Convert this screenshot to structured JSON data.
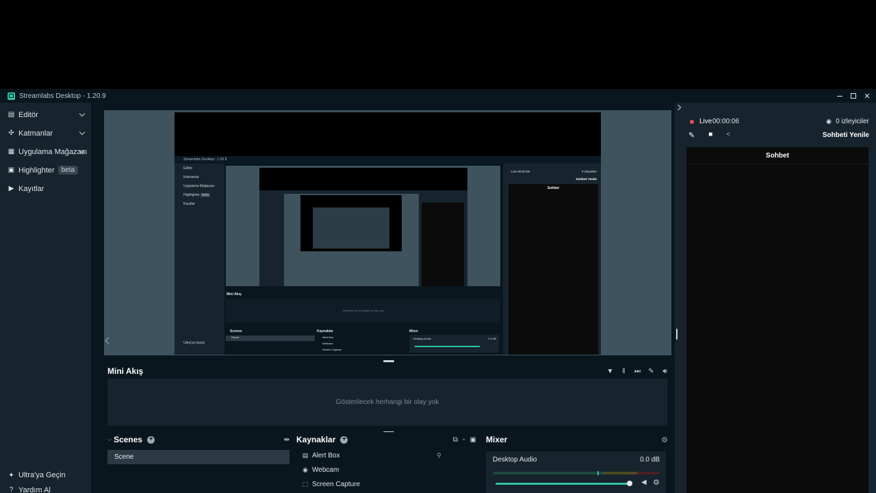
{
  "window": {
    "title": "Streamlabs Desktop - 1.20.9"
  },
  "sidebar": {
    "items": [
      {
        "label": "Editör",
        "icon": "editor-icon",
        "expandable": true
      },
      {
        "label": "Katmanlar",
        "icon": "layers-icon",
        "expandable": true
      },
      {
        "label": "Uygulama Mağazası",
        "icon": "store-icon",
        "expandable": true
      },
      {
        "label": "Highlighter",
        "icon": "highlighter-icon",
        "badge": "beta"
      },
      {
        "label": "Kayıtlar",
        "icon": "recordings-icon"
      }
    ],
    "bottom": [
      {
        "label": "Ultra'ya Geçin",
        "icon": "ultra-icon"
      },
      {
        "label": "Yardım Al",
        "icon": "help-icon"
      }
    ]
  },
  "nested_preview": {
    "title": "Streamlabs Desktop - 1.20.9",
    "nav": [
      "Editör",
      "Katmanlar",
      "Uygulama Mağazası",
      "Highlighter",
      "Kayıtlar"
    ],
    "beta": "beta",
    "ultra": "Ultra'ya Geçin",
    "mini_title": "Mini Akış",
    "mini_empty": "Gösterilecek herhangi bir olay yok",
    "scenes": "Scenes",
    "scene": "Scene",
    "sources": "Kaynaklar",
    "source_items": [
      "Alert Box",
      "Webcam",
      "Screen Capture"
    ],
    "mixer": "Mixer",
    "desktop_audio": "Desktop Audio",
    "db": "0.0 dB",
    "live": "Live 00:00:06",
    "viewers": "0 izleyiciler",
    "refresh": "Sohbeti Yenile",
    "chat": "Sohbet"
  },
  "mini_feed": {
    "title": "Mini Akış",
    "empty": "Gösterilecek herhangi bir olay yok",
    "tools": [
      "filter-icon",
      "pause-icon",
      "skip-icon",
      "mute-alerts-icon",
      "volume-icon"
    ]
  },
  "scenes": {
    "title": "Scenes",
    "items": [
      "Scene"
    ]
  },
  "sources": {
    "title": "Kaynaklar",
    "items": [
      {
        "label": "Alert Box",
        "icon": "alert-box-icon"
      },
      {
        "label": "Webcam",
        "icon": "webcam-icon"
      },
      {
        "label": "Screen Capture",
        "icon": "screen-capture-icon"
      }
    ]
  },
  "mixer": {
    "title": "Mixer",
    "channel": "Desktop Audio",
    "level": "0.0 dB",
    "volume_fraction": 1.0
  },
  "chat": {
    "live_label": "Live",
    "live_time": "00:00:06",
    "viewers": "0 izleyiciler",
    "refresh": "Sohbeti Yenile",
    "header": "Sohbet"
  },
  "colors": {
    "accent": "#31c3a2",
    "live": "#e94b55",
    "panel": "#17242d",
    "bg": "#09161d"
  }
}
